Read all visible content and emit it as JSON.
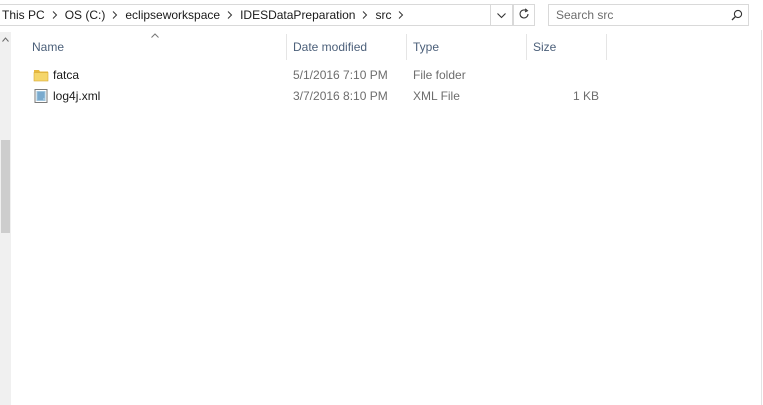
{
  "breadcrumb": {
    "items": [
      "This PC",
      "OS (C:)",
      "eclipseworkspace",
      "IDESDataPreparation",
      "src"
    ]
  },
  "icons": {
    "separator": "chevron-right-icon",
    "dropdown": "chevron-down-icon",
    "refresh": "refresh-icon",
    "search": "search-icon",
    "sort": "sort-ascending-icon",
    "folder": "folder-icon",
    "xml_file": "xml-file-icon"
  },
  "search": {
    "placeholder": "Search src"
  },
  "columns": {
    "name": "Name",
    "date": "Date modified",
    "type": "Type",
    "size": "Size"
  },
  "files": [
    {
      "name": "fatca",
      "date": "5/1/2016 7:10 PM",
      "type": "File folder",
      "size": ""
    },
    {
      "name": "log4j.xml",
      "date": "3/7/2016 8:10 PM",
      "type": "XML File",
      "size": "1 KB"
    }
  ],
  "colors": {
    "header_text": "#4c607a",
    "secondary_text": "#6d6d6d",
    "folder_yellow": "#f5d66b",
    "border": "#d9d9d9"
  }
}
